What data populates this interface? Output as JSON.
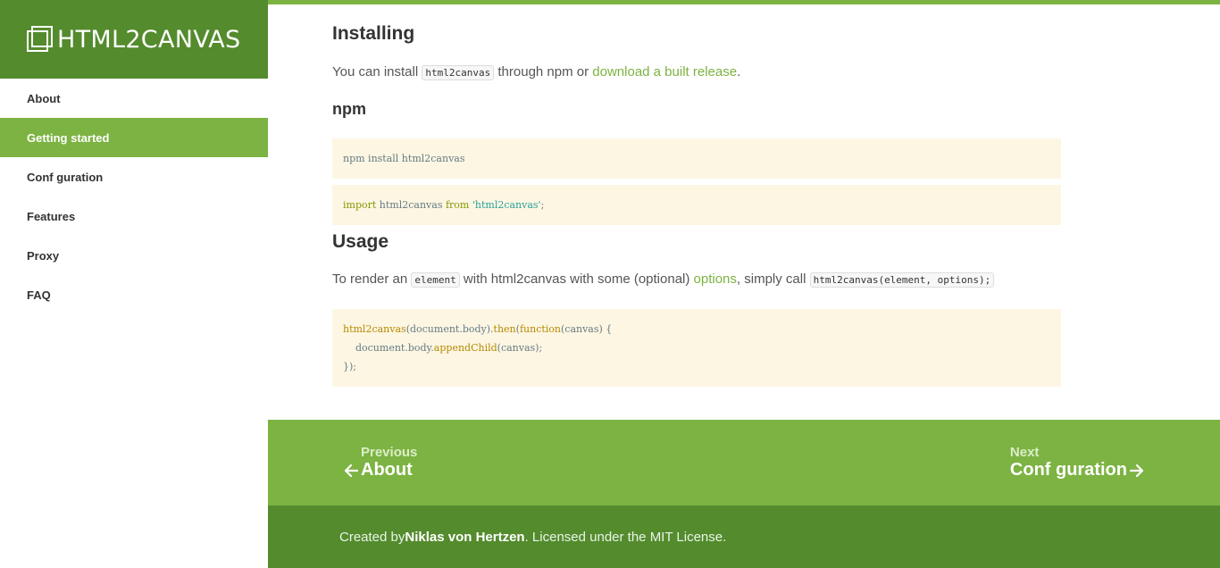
{
  "brand": {
    "name": "HTML2CANVAS"
  },
  "nav": {
    "items": [
      {
        "label": "About"
      },
      {
        "label": "Getting started"
      },
      {
        "label": "Conf guration"
      },
      {
        "label": "Features"
      },
      {
        "label": "Proxy"
      },
      {
        "label": "FAQ"
      }
    ],
    "active_index": 1
  },
  "installing": {
    "heading": "Installing",
    "intro_before": "You can install ",
    "intro_code": "html2canvas",
    "intro_middle": " through npm or ",
    "intro_link": "download a built release",
    "intro_after": "."
  },
  "npm": {
    "heading": "npm",
    "install_cmd": "npm install html2canvas",
    "import_kw": "import",
    "import_name": " html2canvas ",
    "import_from": "from",
    "import_str": "'html2canvas'",
    "import_end": ";"
  },
  "usage": {
    "heading": "Usage",
    "text_1": "To render an ",
    "code_1": "element",
    "text_2": " with html2canvas with some (optional) ",
    "link": "options",
    "text_3": ", simply call ",
    "code_2": "html2canvas(element, options);",
    "code_lines": {
      "l1_fn": "html2canvas",
      "l1_a": "(document.body).",
      "l1_then": "then",
      "l1_b": "(",
      "l1_function": "function",
      "l1_c": "(canvas) {",
      "l2_a": "    document.body.",
      "l2_fn": "appendChild",
      "l2_b": "(canvas);",
      "l3": "});"
    }
  },
  "pager": {
    "prev_small": "Previous",
    "prev_big": "About",
    "next_small": "Next",
    "next_big": "Conf guration"
  },
  "footer": {
    "created_by": "Created by ",
    "author": "Niklas von Hertzen",
    "license": ". Licensed under the MIT License."
  },
  "colors": {
    "brand_dark": "#548b2d",
    "brand_light": "#7cb342",
    "code_bg": "#fdf6e3"
  }
}
